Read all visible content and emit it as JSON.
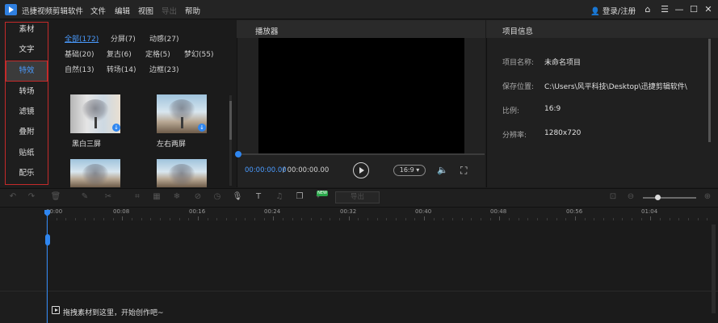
{
  "app": {
    "title": "迅捷视频剪辑软件",
    "menus": [
      {
        "label": "文件",
        "enabled": true
      },
      {
        "label": "编辑",
        "enabled": true
      },
      {
        "label": "视图",
        "enabled": true
      },
      {
        "label": "导出",
        "enabled": false
      },
      {
        "label": "帮助",
        "enabled": true
      }
    ],
    "login_label": "登录/注册",
    "window_icons": [
      "user-icon",
      "home-icon",
      "menu-icon",
      "minimize-icon",
      "maximize-icon",
      "close-icon"
    ]
  },
  "sidebar": {
    "items": [
      "素材",
      "文字",
      "特效",
      "转场",
      "滤镜",
      "叠附",
      "贴纸",
      "配乐"
    ],
    "active_index": 2,
    "highlight_color": "#c42a2a",
    "active_text_color": "#4a9bff"
  },
  "effects": {
    "filters": [
      [
        "全部(172)",
        "分屏(7)",
        "动感(27)"
      ],
      [
        "基础(20)",
        "复古(6)",
        "定格(5)",
        "梦幻(55)"
      ],
      [
        "自然(13)",
        "转场(14)",
        "边框(23)"
      ]
    ],
    "active_filter": "全部(172)",
    "thumbnails": [
      {
        "label": "黑白三屏",
        "style": "bw",
        "downloadable": true
      },
      {
        "label": "左右两屏",
        "style": "color",
        "downloadable": true
      },
      {
        "label": "",
        "style": "color",
        "downloadable": false
      },
      {
        "label": "",
        "style": "color",
        "downloadable": false
      }
    ]
  },
  "player": {
    "title": "播放器",
    "time_current": "00:00:00.00",
    "time_total": "/ 00:00:00.00",
    "ratio": "16:9 ▾",
    "progress": 0,
    "accent": "#2f86f0"
  },
  "project_info": {
    "title": "项目信息",
    "rows": [
      {
        "key": "项目名称:",
        "value": "未命名项目"
      },
      {
        "key": "保存位置:",
        "value": "C:\\Users\\风平科技\\Desktop\\迅捷剪辑软件\\"
      },
      {
        "key": "比例:",
        "value": "16:9"
      },
      {
        "key": "分辨率:",
        "value": "1280x720"
      }
    ]
  },
  "timeline": {
    "toolbar": {
      "tools": [
        "undo-icon",
        "redo-icon",
        "delete-icon",
        "edit-icon",
        "cut-icon",
        "crop-icon",
        "mosaic-icon",
        "freeze-icon",
        "speed-icon",
        "record-icon",
        "text-to-speech-icon",
        "split-audio-icon",
        "copy-icon",
        "ai-icon"
      ],
      "new_badge": "NEW",
      "export_label": "导出",
      "zoom_level": 0.25
    },
    "ruler_labels": [
      "00:00",
      "00:08",
      "00:16",
      "00:24",
      "00:32",
      "00:40",
      "00:48",
      "00:56",
      "01:04"
    ],
    "drop_hint": "拖拽素材到这里，开始创作吧~"
  }
}
